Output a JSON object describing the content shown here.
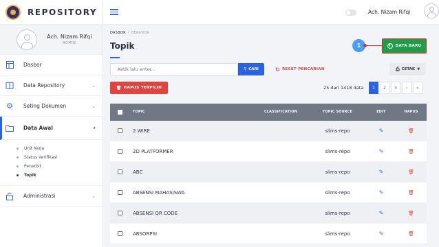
{
  "brand": {
    "name": "REPOSITORY"
  },
  "profile": {
    "name": "Ach. Nizam Rifqi",
    "role": "ADMIN"
  },
  "sidebar": {
    "items": [
      {
        "label": "Dasbor",
        "icon": "dashboard-icon",
        "chevron": ""
      },
      {
        "label": "Data Repository",
        "icon": "book-icon",
        "chevron": "⌄"
      },
      {
        "label": "Seting Dokumen",
        "icon": "gear-icon",
        "chevron": "⌄"
      },
      {
        "label": "Data Awal",
        "icon": "folder-icon",
        "chevron": "›"
      },
      {
        "label": "Administrasi",
        "icon": "lock-icon",
        "chevron": "⌄"
      }
    ],
    "submenu": [
      "Unit Kerja",
      "Status Verifikasi",
      "Penerbit",
      "Topik"
    ]
  },
  "topbar": {
    "user_name": "Ach. Nizam Rifqi"
  },
  "breadcrumb": {
    "root": "DASBOR",
    "sep": "/",
    "current": "BERANDA"
  },
  "page": {
    "title": "Topik"
  },
  "annotation": {
    "number": "1"
  },
  "buttons": {
    "new": "DATA BARU",
    "search": "CARI",
    "reset": "RESET PENCARIAN",
    "print": "CETAK",
    "delete_selected": "HAPUS TERPILIH"
  },
  "search": {
    "placeholder": "Ketik lalu enter..."
  },
  "pagination": {
    "summary": "25 dari 1418 data",
    "pages": [
      "1",
      "2",
      "3",
      "›",
      "»"
    ]
  },
  "table": {
    "columns": {
      "topic": "TOPIC",
      "classification": "CLASSIFICATION",
      "source": "TOPIC SOURCE",
      "edit": "EDIT",
      "delete": "HAPUS"
    },
    "rows": [
      {
        "topic": "2 WIRE",
        "classification": "",
        "source": "slims-repo"
      },
      {
        "topic": "2D PLATFORMER",
        "classification": "",
        "source": "slims-repo"
      },
      {
        "topic": "ABC",
        "classification": "",
        "source": "slims-repo"
      },
      {
        "topic": "ABSENSI MAHASISWA",
        "classification": "",
        "source": "slims-repo"
      },
      {
        "topic": "ABSENSI QR CODE",
        "classification": "",
        "source": "slims-repo"
      },
      {
        "topic": "ABSORPSI",
        "classification": "",
        "source": "slims-repo"
      }
    ]
  },
  "colors": {
    "primary": "#2a63e0",
    "success": "#1f9e4a",
    "danger": "#e0443e",
    "header": "#707785"
  }
}
